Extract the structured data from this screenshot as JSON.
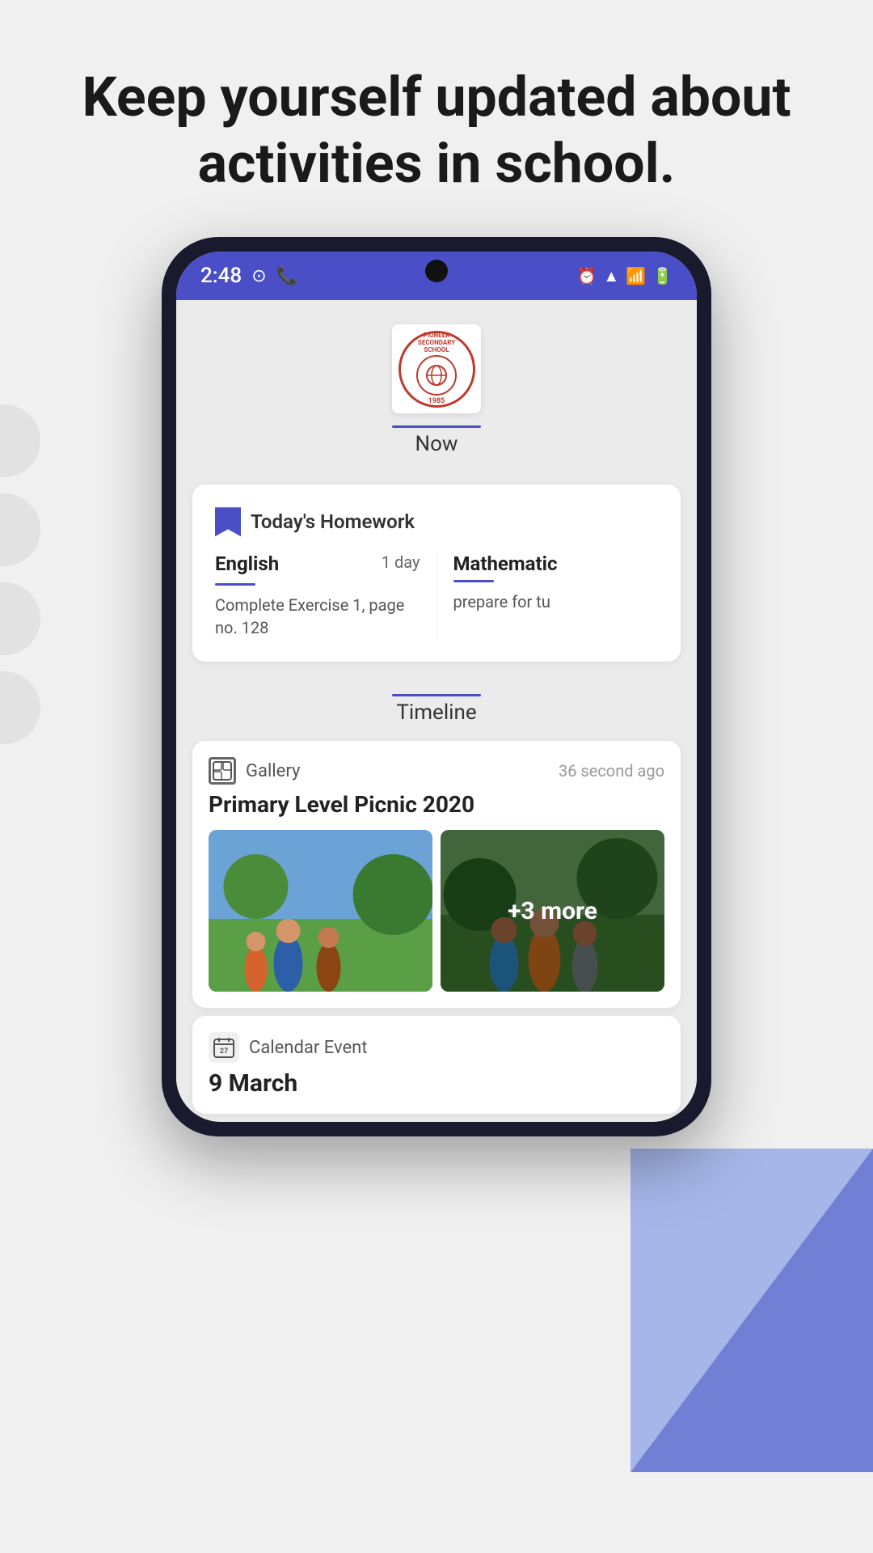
{
  "header": {
    "title": "Keep yourself updated about activities in school."
  },
  "status_bar": {
    "time": "2:48",
    "left_icons": [
      "media-icon",
      "whatsapp-icon"
    ],
    "right_icons": [
      "alarm-icon",
      "wifi-icon",
      "signal-icon",
      "battery-icon"
    ]
  },
  "school": {
    "name": "Pioneer Secondary School",
    "year": "1985",
    "tab_now": "Now"
  },
  "homework": {
    "section_title": "Today's Homework",
    "items": [
      {
        "subject": "English",
        "due": "1 day",
        "description": "Complete Exercise 1, page no. 128"
      },
      {
        "subject": "Mathematic",
        "due": "",
        "description": "prepare for tu"
      }
    ]
  },
  "timeline": {
    "tab_label": "Timeline",
    "gallery_post": {
      "type": "Gallery",
      "time": "36 second ago",
      "title": "Primary Level Picnic 2020",
      "more_count": "+3 more"
    },
    "calendar_post": {
      "type": "Calendar Event",
      "date": "9 March"
    }
  }
}
